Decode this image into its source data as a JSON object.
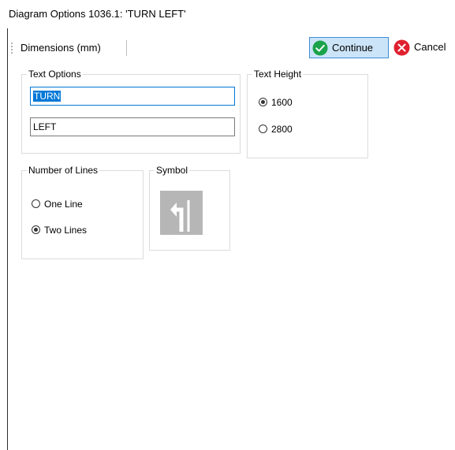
{
  "window": {
    "title": "Diagram Options 1036.1: 'TURN LEFT'"
  },
  "toolbar": {
    "dimensions_label": "Dimensions (mm)",
    "continue_label": "Continue",
    "cancel_label": "Cancel",
    "continue_icon": "checkmark-circle-icon",
    "cancel_icon": "x-circle-icon",
    "continue_color": "#1aa34a",
    "cancel_color": "#e0202e"
  },
  "text_options": {
    "legend": "Text Options",
    "line1_value": "TURN",
    "line2_value": "LEFT"
  },
  "text_height": {
    "legend": "Text Height",
    "options": [
      {
        "label": "1600",
        "selected": true
      },
      {
        "label": "2800",
        "selected": false
      }
    ]
  },
  "number_of_lines": {
    "legend": "Number of Lines",
    "options": [
      {
        "label": "One Line",
        "selected": false
      },
      {
        "label": "Two Lines",
        "selected": true
      }
    ]
  },
  "symbol": {
    "legend": "Symbol",
    "icon": "turn-left-arrow-icon"
  }
}
